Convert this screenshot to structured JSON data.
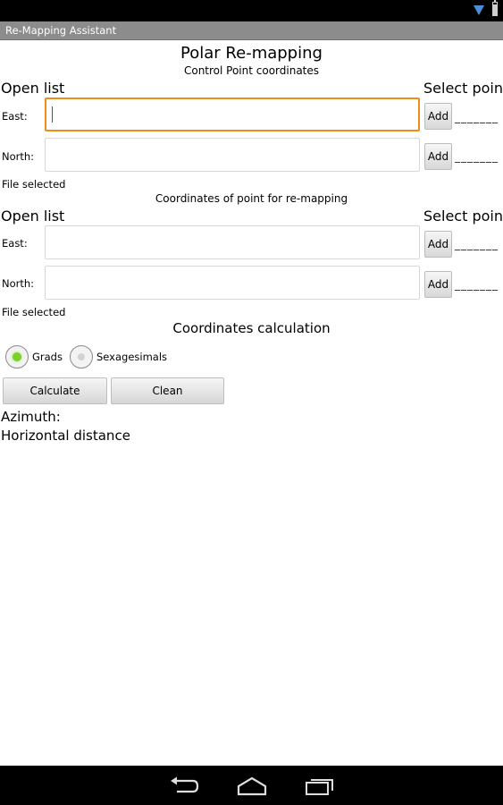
{
  "app": {
    "title": "Re-Mapping Assistant"
  },
  "header": {
    "title": "Polar Re-mapping",
    "subtitle": "Control Point coordinates"
  },
  "control": {
    "open_list": "Open list",
    "select_point": "Select point",
    "east_label": "East:",
    "north_label": "North:",
    "east_value": "",
    "north_value": "",
    "add_label": "Add",
    "dashes": "_______",
    "file_status": "File selected"
  },
  "remap": {
    "title": "Coordinates of point for re-mapping",
    "open_list": "Open list",
    "select_point": "Select point",
    "east_label": "East:",
    "north_label": "North:",
    "east_value": "",
    "north_value": "",
    "add_label": "Add",
    "dashes": "_______",
    "file_status": "File selected"
  },
  "calc": {
    "title": "Coordinates calculation",
    "radio_grads": "Grads",
    "radio_sexagesimals": "Sexagesimals",
    "selected_unit": "Grads",
    "calculate_label": "Calculate",
    "clean_label": "Clean",
    "azimuth_label": "Azimuth:",
    "distance_label": "Horizontal distance"
  },
  "colors": {
    "focus": "#f08c18",
    "radio_on": "#7ad12a",
    "titlebar": "#8c8c8c"
  },
  "icons": {
    "nav": [
      "back-icon",
      "home-icon",
      "recent-apps-icon"
    ],
    "status": [
      "wifi-icon",
      "battery-icon"
    ]
  }
}
